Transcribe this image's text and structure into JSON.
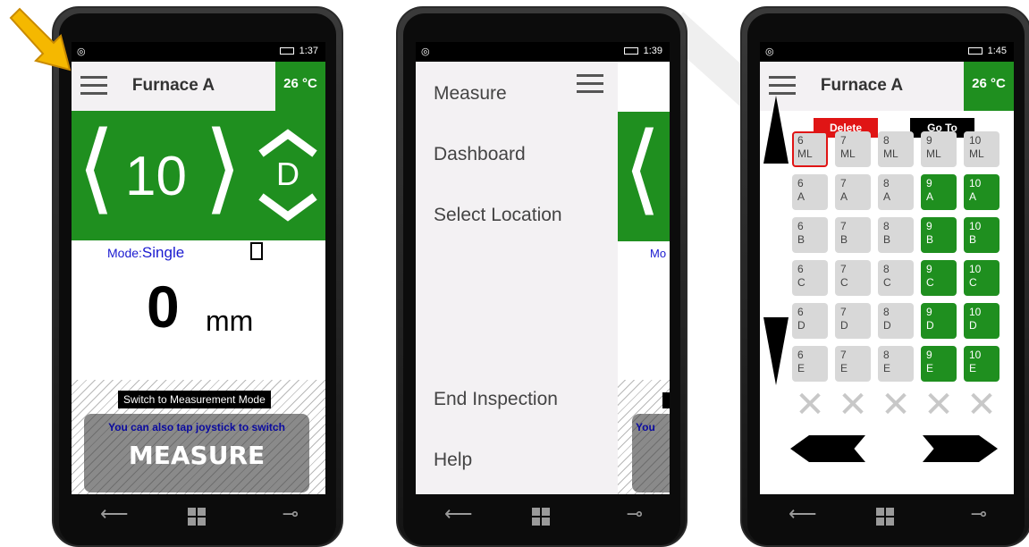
{
  "phone1": {
    "status_time": "1:37",
    "header": {
      "title": "Furnace A",
      "temperature": "26 °C"
    },
    "selector": {
      "position_value": "10",
      "row_letter": "D"
    },
    "mode": {
      "label": "Mode:",
      "value": "Single"
    },
    "reading": {
      "value": "0",
      "unit": "mm"
    },
    "switch_label": "Switch to Measurement Mode",
    "measure_hint": "You can also tap joystick to switch",
    "measure_label": "MEASURE"
  },
  "phone2": {
    "status_time": "1:39",
    "menu_items": [
      "Measure",
      "Dashboard",
      "Select Location",
      "End Inspection",
      "Help"
    ],
    "peek_mode": "Mo",
    "peek_hint": "You"
  },
  "phone3": {
    "status_time": "1:45",
    "header": {
      "title": "Furnace A",
      "temperature": "26 °C"
    },
    "actions": {
      "delete_label": "Delete",
      "goto_label": "Go To"
    },
    "grid_rows": [
      [
        {
          "n": "6",
          "r": "ML",
          "state": "selected"
        },
        {
          "n": "7",
          "r": "ML",
          "state": "gray"
        },
        {
          "n": "8",
          "r": "ML",
          "state": "gray"
        },
        {
          "n": "9",
          "r": "ML",
          "state": "gray"
        },
        {
          "n": "10",
          "r": "ML",
          "state": "gray"
        }
      ],
      [
        {
          "n": "6",
          "r": "A",
          "state": "gray"
        },
        {
          "n": "7",
          "r": "A",
          "state": "gray"
        },
        {
          "n": "8",
          "r": "A",
          "state": "gray"
        },
        {
          "n": "9",
          "r": "A",
          "state": "green"
        },
        {
          "n": "10",
          "r": "A",
          "state": "green"
        }
      ],
      [
        {
          "n": "6",
          "r": "B",
          "state": "gray"
        },
        {
          "n": "7",
          "r": "B",
          "state": "gray"
        },
        {
          "n": "8",
          "r": "B",
          "state": "gray"
        },
        {
          "n": "9",
          "r": "B",
          "state": "green"
        },
        {
          "n": "10",
          "r": "B",
          "state": "green"
        }
      ],
      [
        {
          "n": "6",
          "r": "C",
          "state": "gray"
        },
        {
          "n": "7",
          "r": "C",
          "state": "gray"
        },
        {
          "n": "8",
          "r": "C",
          "state": "gray"
        },
        {
          "n": "9",
          "r": "C",
          "state": "green"
        },
        {
          "n": "10",
          "r": "C",
          "state": "green"
        }
      ],
      [
        {
          "n": "6",
          "r": "D",
          "state": "gray"
        },
        {
          "n": "7",
          "r": "D",
          "state": "gray"
        },
        {
          "n": "8",
          "r": "D",
          "state": "gray"
        },
        {
          "n": "9",
          "r": "D",
          "state": "green"
        },
        {
          "n": "10",
          "r": "D",
          "state": "green"
        }
      ],
      [
        {
          "n": "6",
          "r": "E",
          "state": "gray"
        },
        {
          "n": "7",
          "r": "E",
          "state": "gray"
        },
        {
          "n": "8",
          "r": "E",
          "state": "gray"
        },
        {
          "n": "9",
          "r": "E",
          "state": "green"
        },
        {
          "n": "10",
          "r": "E",
          "state": "green"
        }
      ]
    ],
    "empty_slot_mark": "✕"
  },
  "colors": {
    "brand_green": "#1f8f1f",
    "delete_red": "#e01515",
    "annotation_arrow": "#f5b800",
    "mode_text": "#1a1ad0"
  },
  "icons": [
    "hamburger-menu-icon",
    "arrow-up-icon",
    "arrow-down-icon",
    "chevron-left-icon",
    "chevron-right-icon",
    "annotation-arrow-icon"
  ]
}
